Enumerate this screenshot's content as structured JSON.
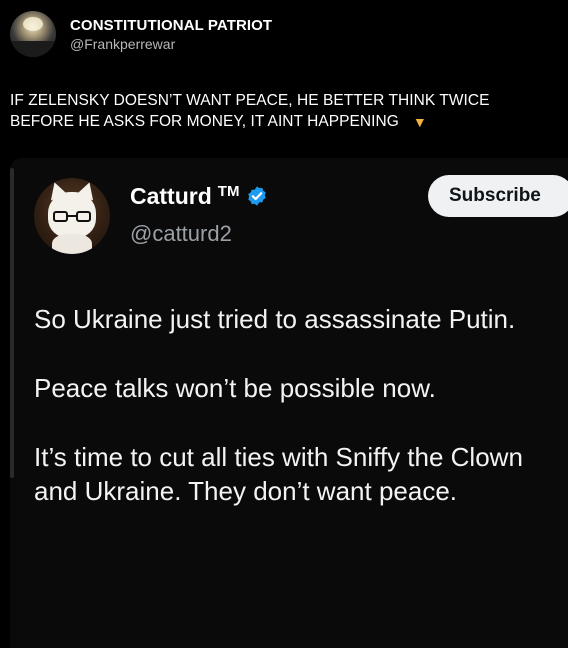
{
  "outer_post": {
    "author_name": "CONSTITUTIONAL PATRIOT",
    "author_handle": "@Frankperrewar",
    "text": "IF ZELENSKY DOESN’T WANT PEACE, HE BETTER THINK TWICE BEFORE HE  ASKS FOR MONEY, IT AINT HAPPENING",
    "trailing_icon": "pointing-down-icon"
  },
  "quoted_post": {
    "author_name": "Catturd",
    "author_name_suffix": "TM",
    "author_handle": "@catturd2",
    "verified_icon": "verified-badge-icon",
    "subscribe_label": "Subscribe",
    "paragraphs": [
      "So Ukraine just tried to assassinate Putin.",
      "Peace talks won’t be possible now.",
      "It’s time to cut all ties with Sniffy the Clown and Ukraine. They don’t want peace."
    ]
  },
  "colors": {
    "background": "#000000",
    "verified_blue": "#1d9bf0",
    "subscribe_bg": "#eff1f3",
    "handle_gray": "#9aa0a6"
  }
}
